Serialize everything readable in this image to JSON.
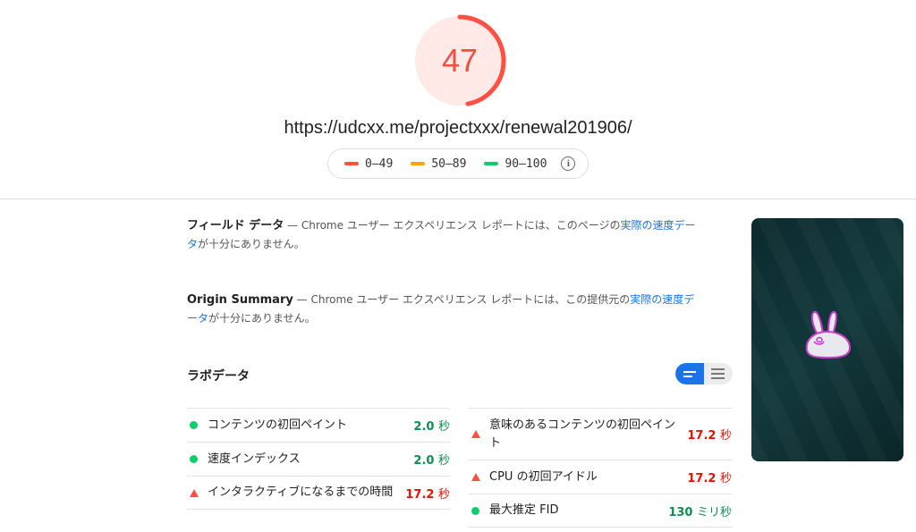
{
  "score": {
    "value": "47",
    "fraction": 0.47,
    "color": "#ff4e42",
    "track_color": "#ffeae8"
  },
  "url": "https://udcxx.me/projectxxx/renewal201906/",
  "legend": [
    {
      "label": "0–49",
      "color": "#ff4e42"
    },
    {
      "label": "50–89",
      "color": "#ffa400"
    },
    {
      "label": "90–100",
      "color": "#0cce6b"
    }
  ],
  "legend_info_icon": "info-icon",
  "field_data": {
    "title": "フィールド データ",
    "dash": " — Chrome ユーザー エクスペリエンス レポートには、このページの",
    "link": "実際の速度データ",
    "tail": "が十分にありません。"
  },
  "origin_summary": {
    "title": "Origin Summary",
    "dash": " — Chrome ユーザー エクスペリエンス レポートには、この提供元の",
    "link": "実際の速度データ",
    "tail": "が十分にありません。"
  },
  "lab_data": {
    "title": "ラボデータ"
  },
  "metrics_left": [
    {
      "label": "コンテンツの初回ペイント",
      "value": "2.0",
      "unit": "秒",
      "status": "good"
    },
    {
      "label": "速度インデックス",
      "value": "2.0",
      "unit": "秒",
      "status": "good"
    },
    {
      "label": "インタラクティブになるまでの時間",
      "value": "17.2",
      "unit": "秒",
      "status": "bad"
    }
  ],
  "metrics_right": [
    {
      "label": "意味のあるコンテンツの初回ペイント",
      "value": "17.2",
      "unit": "秒",
      "status": "bad"
    },
    {
      "label": "CPU の初回アイドル",
      "value": "17.2",
      "unit": "秒",
      "status": "bad"
    },
    {
      "label": "最大推定 FID",
      "value": "130",
      "unit": "ミリ秒",
      "status": "good"
    }
  ]
}
